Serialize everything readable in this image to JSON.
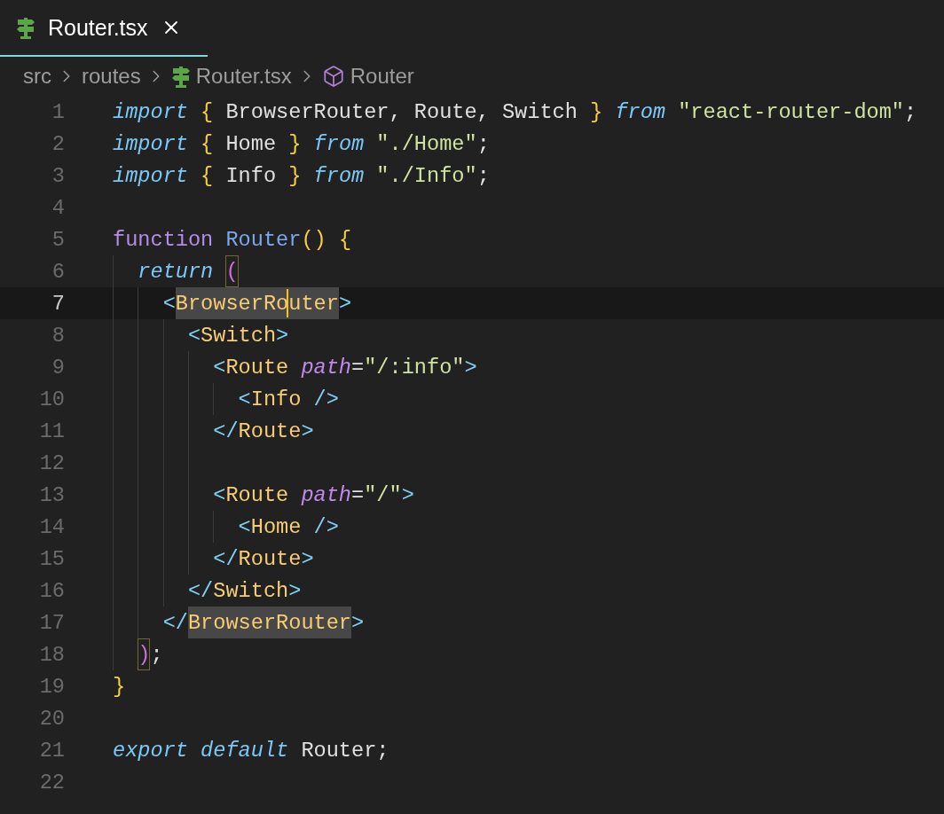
{
  "tab": {
    "title": "Router.tsx",
    "selected": true
  },
  "breadcrumb": [
    {
      "text": "src",
      "kind": "folder"
    },
    {
      "text": "routes",
      "kind": "folder"
    },
    {
      "text": "Router.tsx",
      "kind": "file"
    },
    {
      "text": "Router",
      "kind": "symbol"
    }
  ],
  "lines": [
    {
      "number": "1",
      "current": false,
      "tokens": [
        {
          "kind": "kw",
          "text": "import"
        },
        {
          "kind": "brace",
          "text": " {"
        },
        {
          "kind": "plain",
          "text": " BrowserRouter, Route, Switch"
        },
        {
          "kind": "brace",
          "text": " }"
        },
        {
          "kind": "kw",
          "text": " from"
        },
        {
          "kind": "str",
          "text": " \"react-router-dom\""
        },
        {
          "kind": "plain",
          "text": ";"
        }
      ]
    },
    {
      "number": "2",
      "current": false,
      "tokens": [
        {
          "kind": "kw",
          "text": "import"
        },
        {
          "kind": "brace",
          "text": " {"
        },
        {
          "kind": "plain",
          "text": " Home"
        },
        {
          "kind": "brace",
          "text": " }"
        },
        {
          "kind": "kw",
          "text": " from"
        },
        {
          "kind": "str",
          "text": " \"./Home\""
        },
        {
          "kind": "plain",
          "text": ";"
        }
      ]
    },
    {
      "number": "3",
      "current": false,
      "tokens": [
        {
          "kind": "kw",
          "text": "import"
        },
        {
          "kind": "brace",
          "text": " {"
        },
        {
          "kind": "plain",
          "text": " Info"
        },
        {
          "kind": "brace",
          "text": " }"
        },
        {
          "kind": "kw",
          "text": " from"
        },
        {
          "kind": "str",
          "text": " \"./Info\""
        },
        {
          "kind": "plain",
          "text": ";"
        }
      ]
    },
    {
      "number": "4",
      "current": false
    },
    {
      "number": "5",
      "current": false,
      "tokens": [
        {
          "kind": "storage",
          "text": "function"
        },
        {
          "kind": "fn",
          "text": " Router"
        },
        {
          "kind": "brace",
          "text": "()"
        },
        {
          "kind": "brace",
          "text": " {"
        }
      ],
      "children": [
        {
          "number": "6",
          "current": false,
          "tokens": [
            {
              "kind": "kw",
              "text": "return "
            },
            {
              "kind": "paren",
              "text": "(",
              "match": true
            }
          ],
          "children": [
            {
              "number": "7",
              "current": true,
              "tokens": [
                {
                  "kind": "tag",
                  "text": "<"
                },
                {
                  "kind": "tagname",
                  "text": "BrowserRo",
                  "highlight": true,
                  "cursor": true
                },
                {
                  "kind": "tagname",
                  "text": "uter",
                  "highlight": true
                },
                {
                  "kind": "tag",
                  "text": ">"
                }
              ],
              "children": [
                {
                  "number": "8",
                  "current": false,
                  "tokens": [
                    {
                      "kind": "tag",
                      "text": "<"
                    },
                    {
                      "kind": "tagname",
                      "text": "Switch"
                    },
                    {
                      "kind": "tag",
                      "text": ">"
                    }
                  ],
                  "children": [
                    {
                      "number": "9",
                      "current": false,
                      "tokens": [
                        {
                          "kind": "tag",
                          "text": "<"
                        },
                        {
                          "kind": "tagname",
                          "text": "Route"
                        },
                        {
                          "kind": "attr",
                          "text": " path"
                        },
                        {
                          "kind": "plain",
                          "text": "="
                        },
                        {
                          "kind": "str",
                          "text": "\"/:info\""
                        },
                        {
                          "kind": "tag",
                          "text": ">"
                        }
                      ],
                      "children": [
                        {
                          "number": "10",
                          "current": false,
                          "tokens": [
                            {
                              "kind": "tag",
                              "text": "<"
                            },
                            {
                              "kind": "tagname",
                              "text": "Info"
                            },
                            {
                              "kind": "tag",
                              "text": " />"
                            }
                          ]
                        }
                      ]
                    },
                    {
                      "number": "11",
                      "current": false,
                      "tokens": [
                        {
                          "kind": "tag",
                          "text": "</"
                        },
                        {
                          "kind": "tagname",
                          "text": "Route"
                        },
                        {
                          "kind": "tag",
                          "text": ">"
                        }
                      ]
                    },
                    {
                      "number": "12",
                      "current": false
                    },
                    {
                      "number": "13",
                      "current": false,
                      "tokens": [
                        {
                          "kind": "tag",
                          "text": "<"
                        },
                        {
                          "kind": "tagname",
                          "text": "Route"
                        },
                        {
                          "kind": "attr",
                          "text": " path"
                        },
                        {
                          "kind": "plain",
                          "text": "="
                        },
                        {
                          "kind": "str",
                          "text": "\"/\""
                        },
                        {
                          "kind": "tag",
                          "text": ">"
                        }
                      ],
                      "children": [
                        {
                          "number": "14",
                          "current": false,
                          "tokens": [
                            {
                              "kind": "tag",
                              "text": "<"
                            },
                            {
                              "kind": "tagname",
                              "text": "Home"
                            },
                            {
                              "kind": "tag",
                              "text": " />"
                            }
                          ]
                        }
                      ]
                    },
                    {
                      "number": "15",
                      "current": false,
                      "tokens": [
                        {
                          "kind": "tag",
                          "text": "</"
                        },
                        {
                          "kind": "tagname",
                          "text": "Route"
                        },
                        {
                          "kind": "tag",
                          "text": ">"
                        }
                      ]
                    }
                  ]
                },
                {
                  "number": "16",
                  "current": false,
                  "tokens": [
                    {
                      "kind": "tag",
                      "text": "</"
                    },
                    {
                      "kind": "tagname",
                      "text": "Switch"
                    },
                    {
                      "kind": "tag",
                      "text": ">"
                    }
                  ]
                }
              ]
            },
            {
              "number": "17",
              "current": false,
              "tokens": [
                {
                  "kind": "tag",
                  "text": "</"
                },
                {
                  "kind": "tagname",
                  "text": "BrowserRouter",
                  "highlight": true
                },
                {
                  "kind": "tag",
                  "text": ">"
                }
              ]
            }
          ]
        },
        {
          "number": "18",
          "current": false,
          "tokens": [
            {
              "kind": "paren",
              "text": ")",
              "match": true
            },
            {
              "kind": "plain",
              "text": ";"
            }
          ]
        }
      ]
    },
    {
      "number": "19",
      "current": false,
      "tokens": [
        {
          "kind": "brace",
          "text": "}"
        }
      ]
    },
    {
      "number": "20",
      "current": false
    },
    {
      "number": "21",
      "current": false,
      "tokens": [
        {
          "kind": "kw",
          "text": "export default"
        },
        {
          "kind": "plain",
          "text": " Router;"
        }
      ]
    },
    {
      "number": "22",
      "current": false
    }
  ]
}
